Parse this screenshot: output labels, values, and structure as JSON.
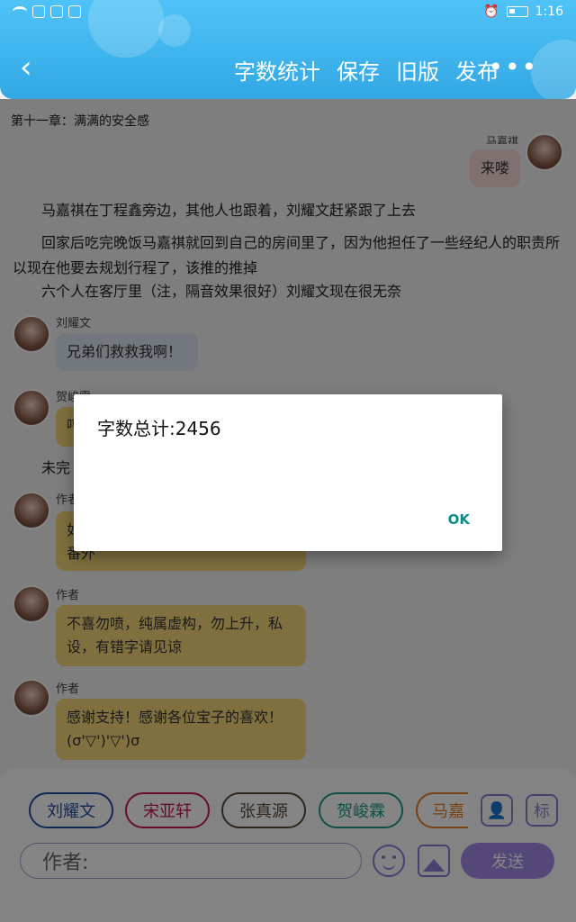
{
  "status_bar": {
    "time": "1:16"
  },
  "header": {
    "actions": [
      "字数统计",
      "保存",
      "旧版",
      "发布"
    ]
  },
  "chapter_title": "第十一章：满满的安全感",
  "messages": {
    "top_right": {
      "sender": "马嘉祺",
      "text": "来喽"
    },
    "para1": "马嘉祺在丁程鑫旁边，其他人也跟着，刘耀文赶紧跟了上去",
    "para2": "回家后吃完晚饭马嘉祺就回到自己的房间里了，因为他担任了一些经纪人的职责所以现在他要去规划行程了，该推的推掉",
    "para3": "六个人在客厅里（注，隔音效果很好）刘耀文现在很无奈",
    "m1": {
      "sender": "刘耀文",
      "text": "兄弟们救救我啊！"
    },
    "m2": {
      "sender": "贺峻霖",
      "text": "哼"
    },
    "para4": "未完",
    "m3": {
      "sender": "作者",
      "text": "如\n番外"
    },
    "m4": {
      "sender": "作者",
      "text": "不喜勿喷，纯属虚构，勿上升，私设，有错字请见谅"
    },
    "m5": {
      "sender": "作者",
      "text": "感谢支持！感谢各位宝子的喜欢！(σ'▽')'▽')σ"
    }
  },
  "chips": [
    {
      "label": "刘耀文",
      "color": "#1f4fa3"
    },
    {
      "label": "宋亚轩",
      "color": "#c2185b"
    },
    {
      "label": "张真源",
      "color": "#5a4a3a"
    },
    {
      "label": "贺峻霖",
      "color": "#1b9a8a"
    },
    {
      "label": "马嘉",
      "color": "#e67e22"
    }
  ],
  "toolbar": {
    "tag_label": "标"
  },
  "input": {
    "placeholder": "作者:"
  },
  "send_label": "发送",
  "dialog": {
    "message": "字数总计:2456",
    "ok_label": "OK"
  }
}
